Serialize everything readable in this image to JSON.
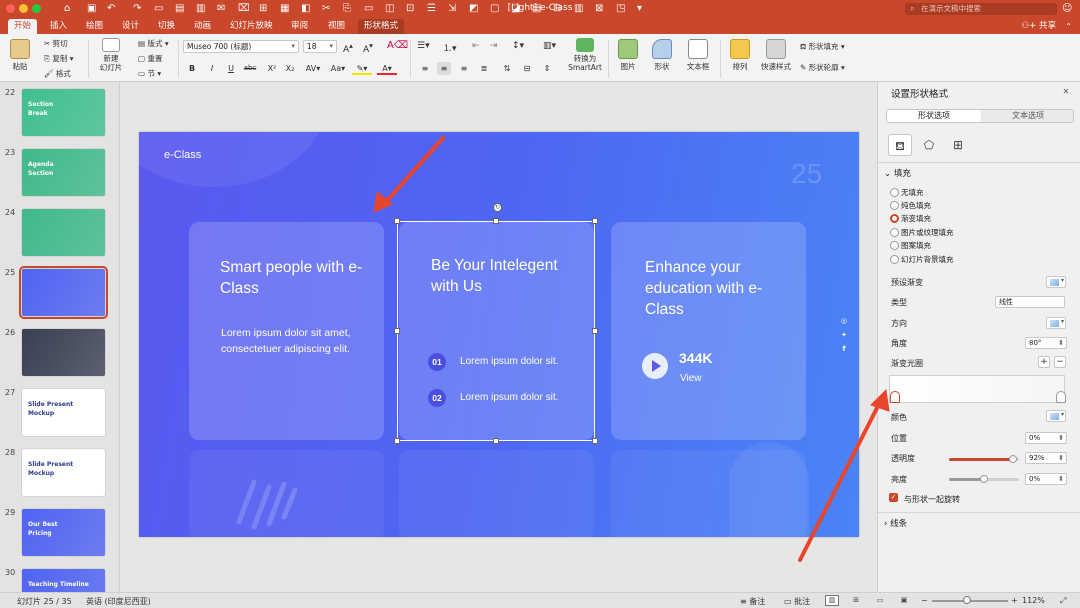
{
  "window": {
    "title": "[Light] e-Class",
    "search_placeholder": "在演示文稿中搜索"
  },
  "colors": {
    "accent": "#c9472a",
    "slide_start": "#5a58f0",
    "slide_end": "#4a84f6"
  },
  "tabs": [
    {
      "label": "开始",
      "active": true
    },
    {
      "label": "插入"
    },
    {
      "label": "绘图"
    },
    {
      "label": "设计"
    },
    {
      "label": "切换"
    },
    {
      "label": "动画"
    },
    {
      "label": "幻灯片放映"
    },
    {
      "label": "审阅"
    },
    {
      "label": "视图"
    },
    {
      "label": "形状格式",
      "contextual": true
    }
  ],
  "share_label": "共享",
  "ribbon": {
    "paste": "粘贴",
    "cut": "剪切",
    "copy": "复制",
    "format": "格式",
    "new_slide": "新建\n幻灯片",
    "layout": "版式",
    "reset": "重置",
    "section": "节",
    "font_name": "Museo 700 (标题)",
    "font_size": "18",
    "convert_smartart": "转换为\nSmartArt",
    "picture": "图片",
    "shape": "形状",
    "textbox": "文本框",
    "arrange": "排列",
    "quick_styles": "快速样式",
    "shape_fill": "形状填充",
    "shape_outline": "形状轮廓"
  },
  "thumbnails": [
    {
      "num": "22",
      "label1": "Section",
      "label2": "Break",
      "color": "#3fbf8f"
    },
    {
      "num": "23",
      "label1": "Agenda",
      "label2": "Section",
      "color": "#3fb98a"
    },
    {
      "num": "24",
      "label1": "",
      "label2": "",
      "color": "#3fb98a"
    },
    {
      "num": "25",
      "label1": "",
      "label2": "",
      "color": "#4f63f2",
      "selected": true
    },
    {
      "num": "26",
      "label1": "",
      "label2": "",
      "color": "#3a3f52"
    },
    {
      "num": "27",
      "label1": "Slide Present",
      "label2": "Mockup",
      "color": "#ffffff"
    },
    {
      "num": "28",
      "label1": "Slide Present",
      "label2": "Mockup",
      "color": "#ffffff"
    },
    {
      "num": "29",
      "label1": "Our Best",
      "label2": "Pricing",
      "color": "#4f63f2"
    },
    {
      "num": "30",
      "label1": "Teaching Timeline",
      "label2": "",
      "color": "#4f63f2"
    }
  ],
  "slide": {
    "logo": "e-Class",
    "number": "25",
    "card1": {
      "title": "Smart people with e-Class",
      "body": "Lorem ipsum dolor sit amet, consectetuer adipiscing elit."
    },
    "card2": {
      "title": "Be Your Intelegent with Us",
      "items": [
        {
          "num": "01",
          "text": "Lorem ipsum dolor sit."
        },
        {
          "num": "02",
          "text": "Lorem ipsum dolor sit."
        }
      ]
    },
    "card3": {
      "title": "Enhance your education with e-Class",
      "stat_value": "344K",
      "stat_label": "View"
    }
  },
  "pane": {
    "title": "设置形状格式",
    "tab_shape": "形状选项",
    "tab_text": "文本选项",
    "fill_section": "填充",
    "fill_options": [
      {
        "label": "无填充"
      },
      {
        "label": "纯色填充"
      },
      {
        "label": "渐变填充",
        "selected": true
      },
      {
        "label": "图片或纹理填充"
      },
      {
        "label": "图案填充"
      },
      {
        "label": "幻灯片背景填充"
      }
    ],
    "preset_gradient": "预设渐变",
    "type_label": "类型",
    "type_value": "线性",
    "direction_label": "方向",
    "angle_label": "角度",
    "angle_value": "80°",
    "stops_label": "渐变光圈",
    "color_label": "颜色",
    "position_label": "位置",
    "position_value": "0%",
    "transparency_label": "透明度",
    "transparency_value": "92%",
    "transparency_level": 0.92,
    "brightness_label": "亮度",
    "brightness_value": "0%",
    "brightness_level": 0.5,
    "rotate_with_shape": "与形状一起旋转",
    "line_section": "线条"
  },
  "status": {
    "slide_info": "幻灯片 25 / 35",
    "language": "英语 (印度尼西亚)",
    "notes": "备注",
    "comments": "批注",
    "zoom": "112%"
  }
}
